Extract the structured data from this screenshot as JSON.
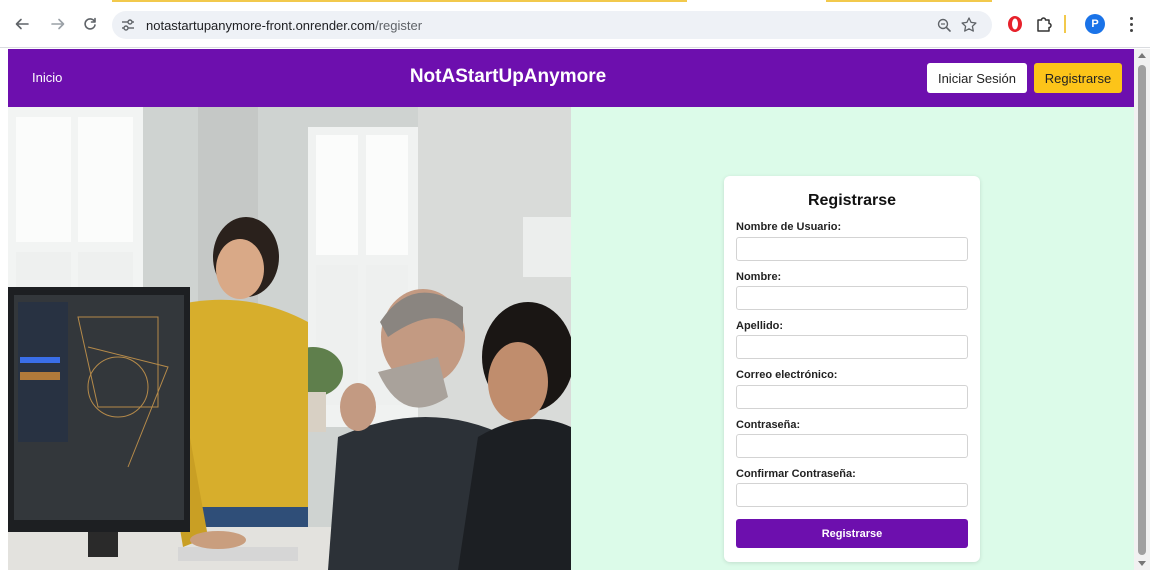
{
  "browser": {
    "url_host": "notastartupanymore-front.onrender.com",
    "url_path": "/register",
    "profile_initial": "P",
    "icons": {
      "back": "back-arrow-icon",
      "forward": "forward-arrow-icon",
      "reload": "reload-icon",
      "site_info": "site-settings-icon",
      "zoom": "zoom-icon",
      "bookmark": "star-icon",
      "opera_ext": "opera-extension-icon",
      "extensions": "puzzle-icon",
      "menu": "three-dots-icon"
    }
  },
  "header": {
    "home_label": "Inicio",
    "brand": "NotAStartUpAnymore",
    "login_label": "Iniciar Sesión",
    "register_label": "Registrarse"
  },
  "form": {
    "title": "Registrarse",
    "fields": [
      {
        "label": "Nombre de Usuario:",
        "value": ""
      },
      {
        "label": "Nombre:",
        "value": ""
      },
      {
        "label": "Apellido:",
        "value": ""
      },
      {
        "label": "Correo electrónico:",
        "value": ""
      },
      {
        "label": "Contraseña:",
        "value": ""
      },
      {
        "label": "Confirmar Contraseña:",
        "value": ""
      }
    ],
    "submit_label": "Registrarse"
  },
  "colors": {
    "header_bg": "#6d0fae",
    "register_button_bg": "#fcc419",
    "panel_bg": "#dcfbe9",
    "submit_bg": "#6d0fae"
  }
}
